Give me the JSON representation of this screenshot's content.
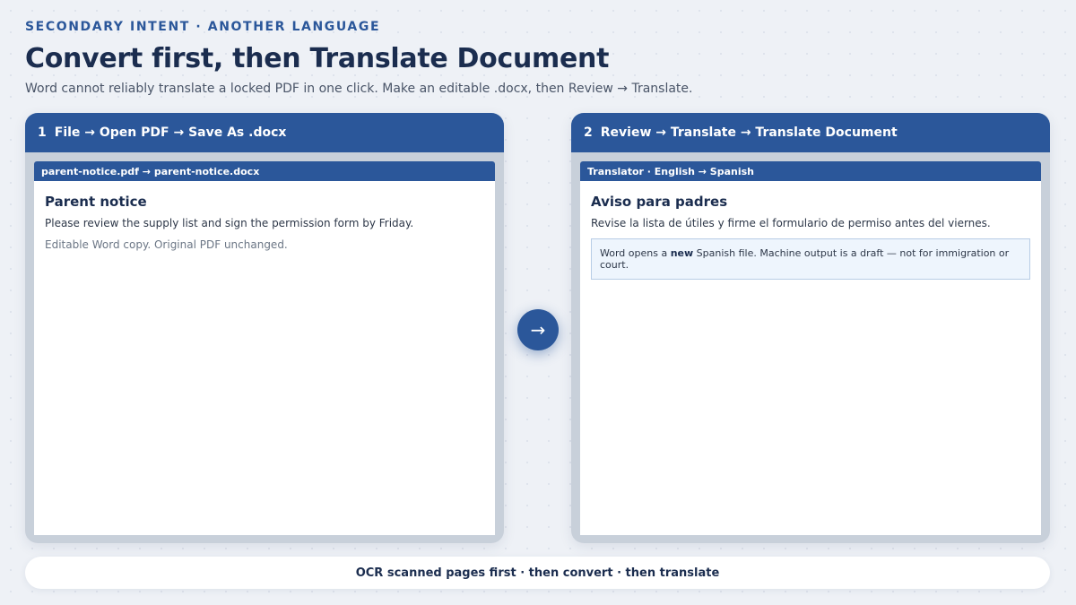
{
  "header": {
    "eyebrow": "SECONDARY INTENT · ANOTHER LANGUAGE",
    "title": "Convert first, then Translate Document",
    "subtitle": "Word cannot reliably translate a locked PDF in one click. Make an editable .docx, then Review → Translate."
  },
  "step1": {
    "number": "1",
    "label": "File → Open PDF → Save As .docx",
    "doc_bar": "parent-notice.pdf → parent-notice.docx",
    "heading": "Parent notice",
    "text": "Please review the supply list and sign the permission form by Friday.",
    "note": "Editable Word copy. Original PDF unchanged."
  },
  "step2": {
    "number": "2",
    "label": "Review → Translate → Translate Document",
    "doc_bar": "Translator · English → Spanish",
    "heading": "Aviso para padres",
    "text": "Revise la lista de útiles y firme el formulario de permiso antes del viernes.",
    "callout_pre": "Word opens a ",
    "callout_bold": "new",
    "callout_post": " Spanish file. Machine output is a draft — not for immigration or court."
  },
  "arrow": {
    "glyph": "→",
    "icon": "arrow-right-icon"
  },
  "footer": {
    "text": "OCR scanned pages first · then convert · then translate"
  },
  "colors": {
    "accent": "#2b579a",
    "title": "#1b2d4f",
    "panel_bg": "#c8d0da",
    "page_bg": "#eef1f6"
  }
}
